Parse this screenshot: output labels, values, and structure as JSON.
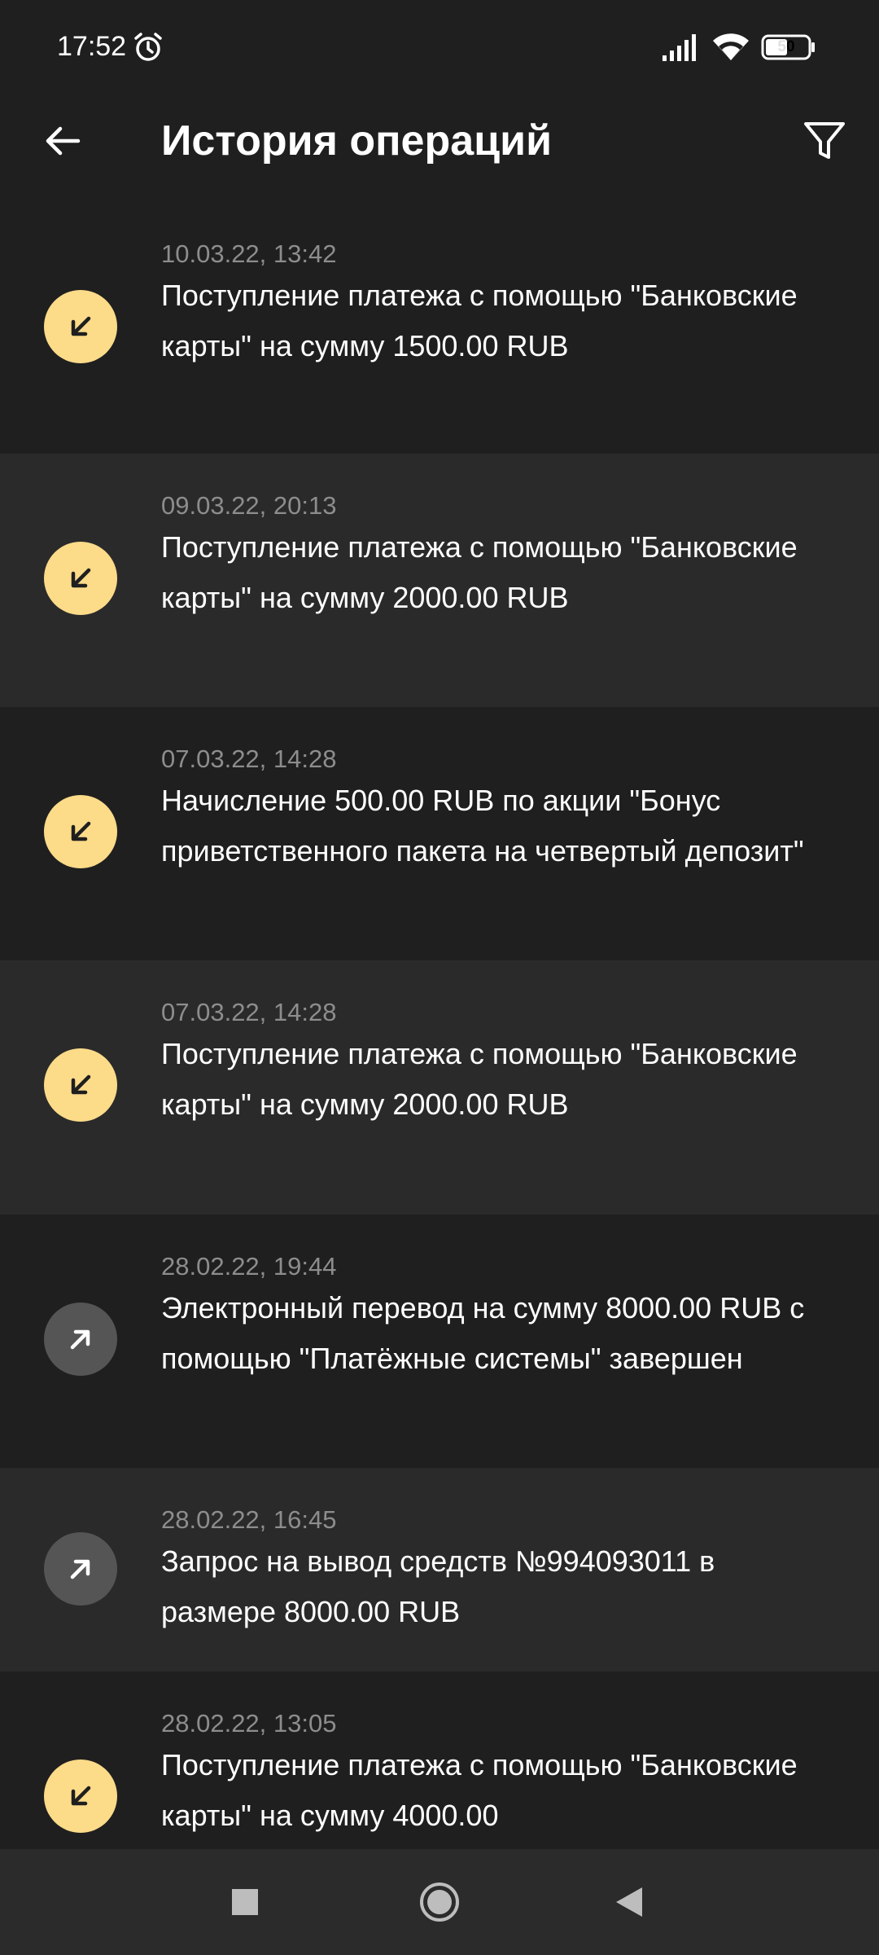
{
  "status_bar": {
    "time": "17:52",
    "battery": "50"
  },
  "header": {
    "title": "История операций"
  },
  "transactions": [
    {
      "date": "10.03.22, 13:42",
      "text": "Поступление платежа с помощью \"Банковские карты\" на сумму 1500.00 RUB",
      "direction": "incoming"
    },
    {
      "date": "09.03.22, 20:13",
      "text": "Поступление платежа с помощью \"Банковские карты\" на сумму 2000.00 RUB",
      "direction": "incoming"
    },
    {
      "date": "07.03.22, 14:28",
      "text": "Начисление 500.00 RUB по акции \"Бонус приветственного пакета на четвертый депозит\"",
      "direction": "incoming"
    },
    {
      "date": "07.03.22, 14:28",
      "text": "Поступление платежа с помощью \"Банковские карты\" на сумму 2000.00 RUB",
      "direction": "incoming"
    },
    {
      "date": "28.02.22, 19:44",
      "text": "Электронный перевод на сумму 8000.00 RUB с помощью \"Платёжные системы\" завершен",
      "direction": "outgoing"
    },
    {
      "date": "28.02.22, 16:45",
      "text": "Запрос на вывод средств №994093011 в размере 8000.00 RUB",
      "direction": "outgoing"
    },
    {
      "date": "28.02.22, 13:05",
      "text": "Поступление платежа с помощью \"Банковские карты\" на сумму 4000.00",
      "direction": "incoming"
    }
  ],
  "colors": {
    "background": "#1f1f1f",
    "row_alt": "#2a2a2a",
    "incoming_accent": "#fcdb89",
    "outgoing_accent": "#555555",
    "date_text": "#8d8d8d"
  }
}
